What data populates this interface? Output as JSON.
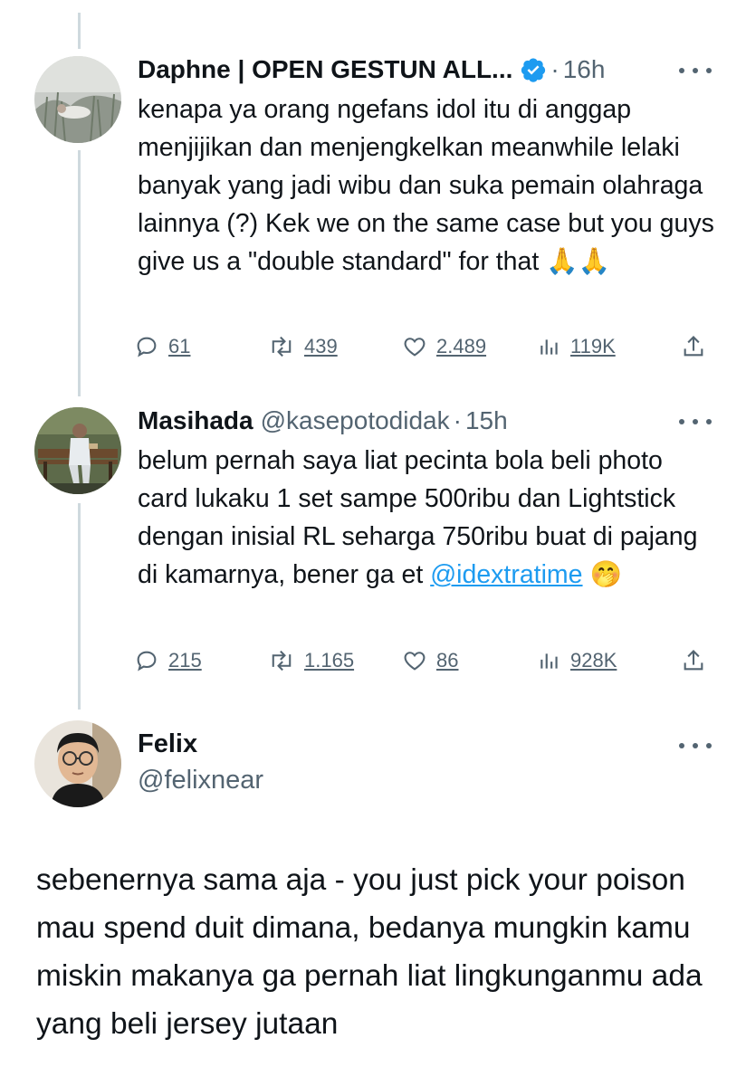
{
  "thread": [
    {
      "author_name": "Daphne | OPEN GESTUN ALL...",
      "handle": "",
      "separator": "·",
      "time": "16h",
      "text": "kenapa ya orang ngefans idol itu di anggap menjijikan dan menjengkelkan meanwhile lelaki banyak yang jadi wibu dan suka pemain olahraga lainnya (?) Kek we on the same case but you guys give us a \"double standard\" for that",
      "emoji": "🙏🙏",
      "replies": "61",
      "reposts": "439",
      "likes": "2.489",
      "views": "119K"
    },
    {
      "author_name": "Masihada",
      "handle": "@kasepotodidak",
      "separator": "·",
      "time": "15h",
      "text": "belum pernah saya liat pecinta bola beli photo card lukaku 1 set sampe 500ribu dan Lightstick dengan inisial RL seharga 750ribu buat di pajang di kamarnya, bener ga et",
      "mention": "@idextratime",
      "emoji": "🤭",
      "replies": "215",
      "reposts": "1.165",
      "likes": "86",
      "views": "928K"
    }
  ],
  "main_tweet": {
    "author_name": "Felix",
    "handle": "@felixnear",
    "text": "sebenernya sama aja - you just pick your poison mau spend duit dimana, bedanya mungkin kamu miskin makanya ga pernah liat lingkunganmu ada yang beli jersey jutaan"
  },
  "colors": {
    "text": "#0f1419",
    "secondary": "#536471",
    "link": "#1d9bf0",
    "verified": "#1d9bf0",
    "thread_line": "#cfd9de"
  },
  "icons": [
    "reply-icon",
    "repost-icon",
    "like-icon",
    "views-icon",
    "share-icon",
    "more-icon",
    "verified-badge-icon"
  ]
}
